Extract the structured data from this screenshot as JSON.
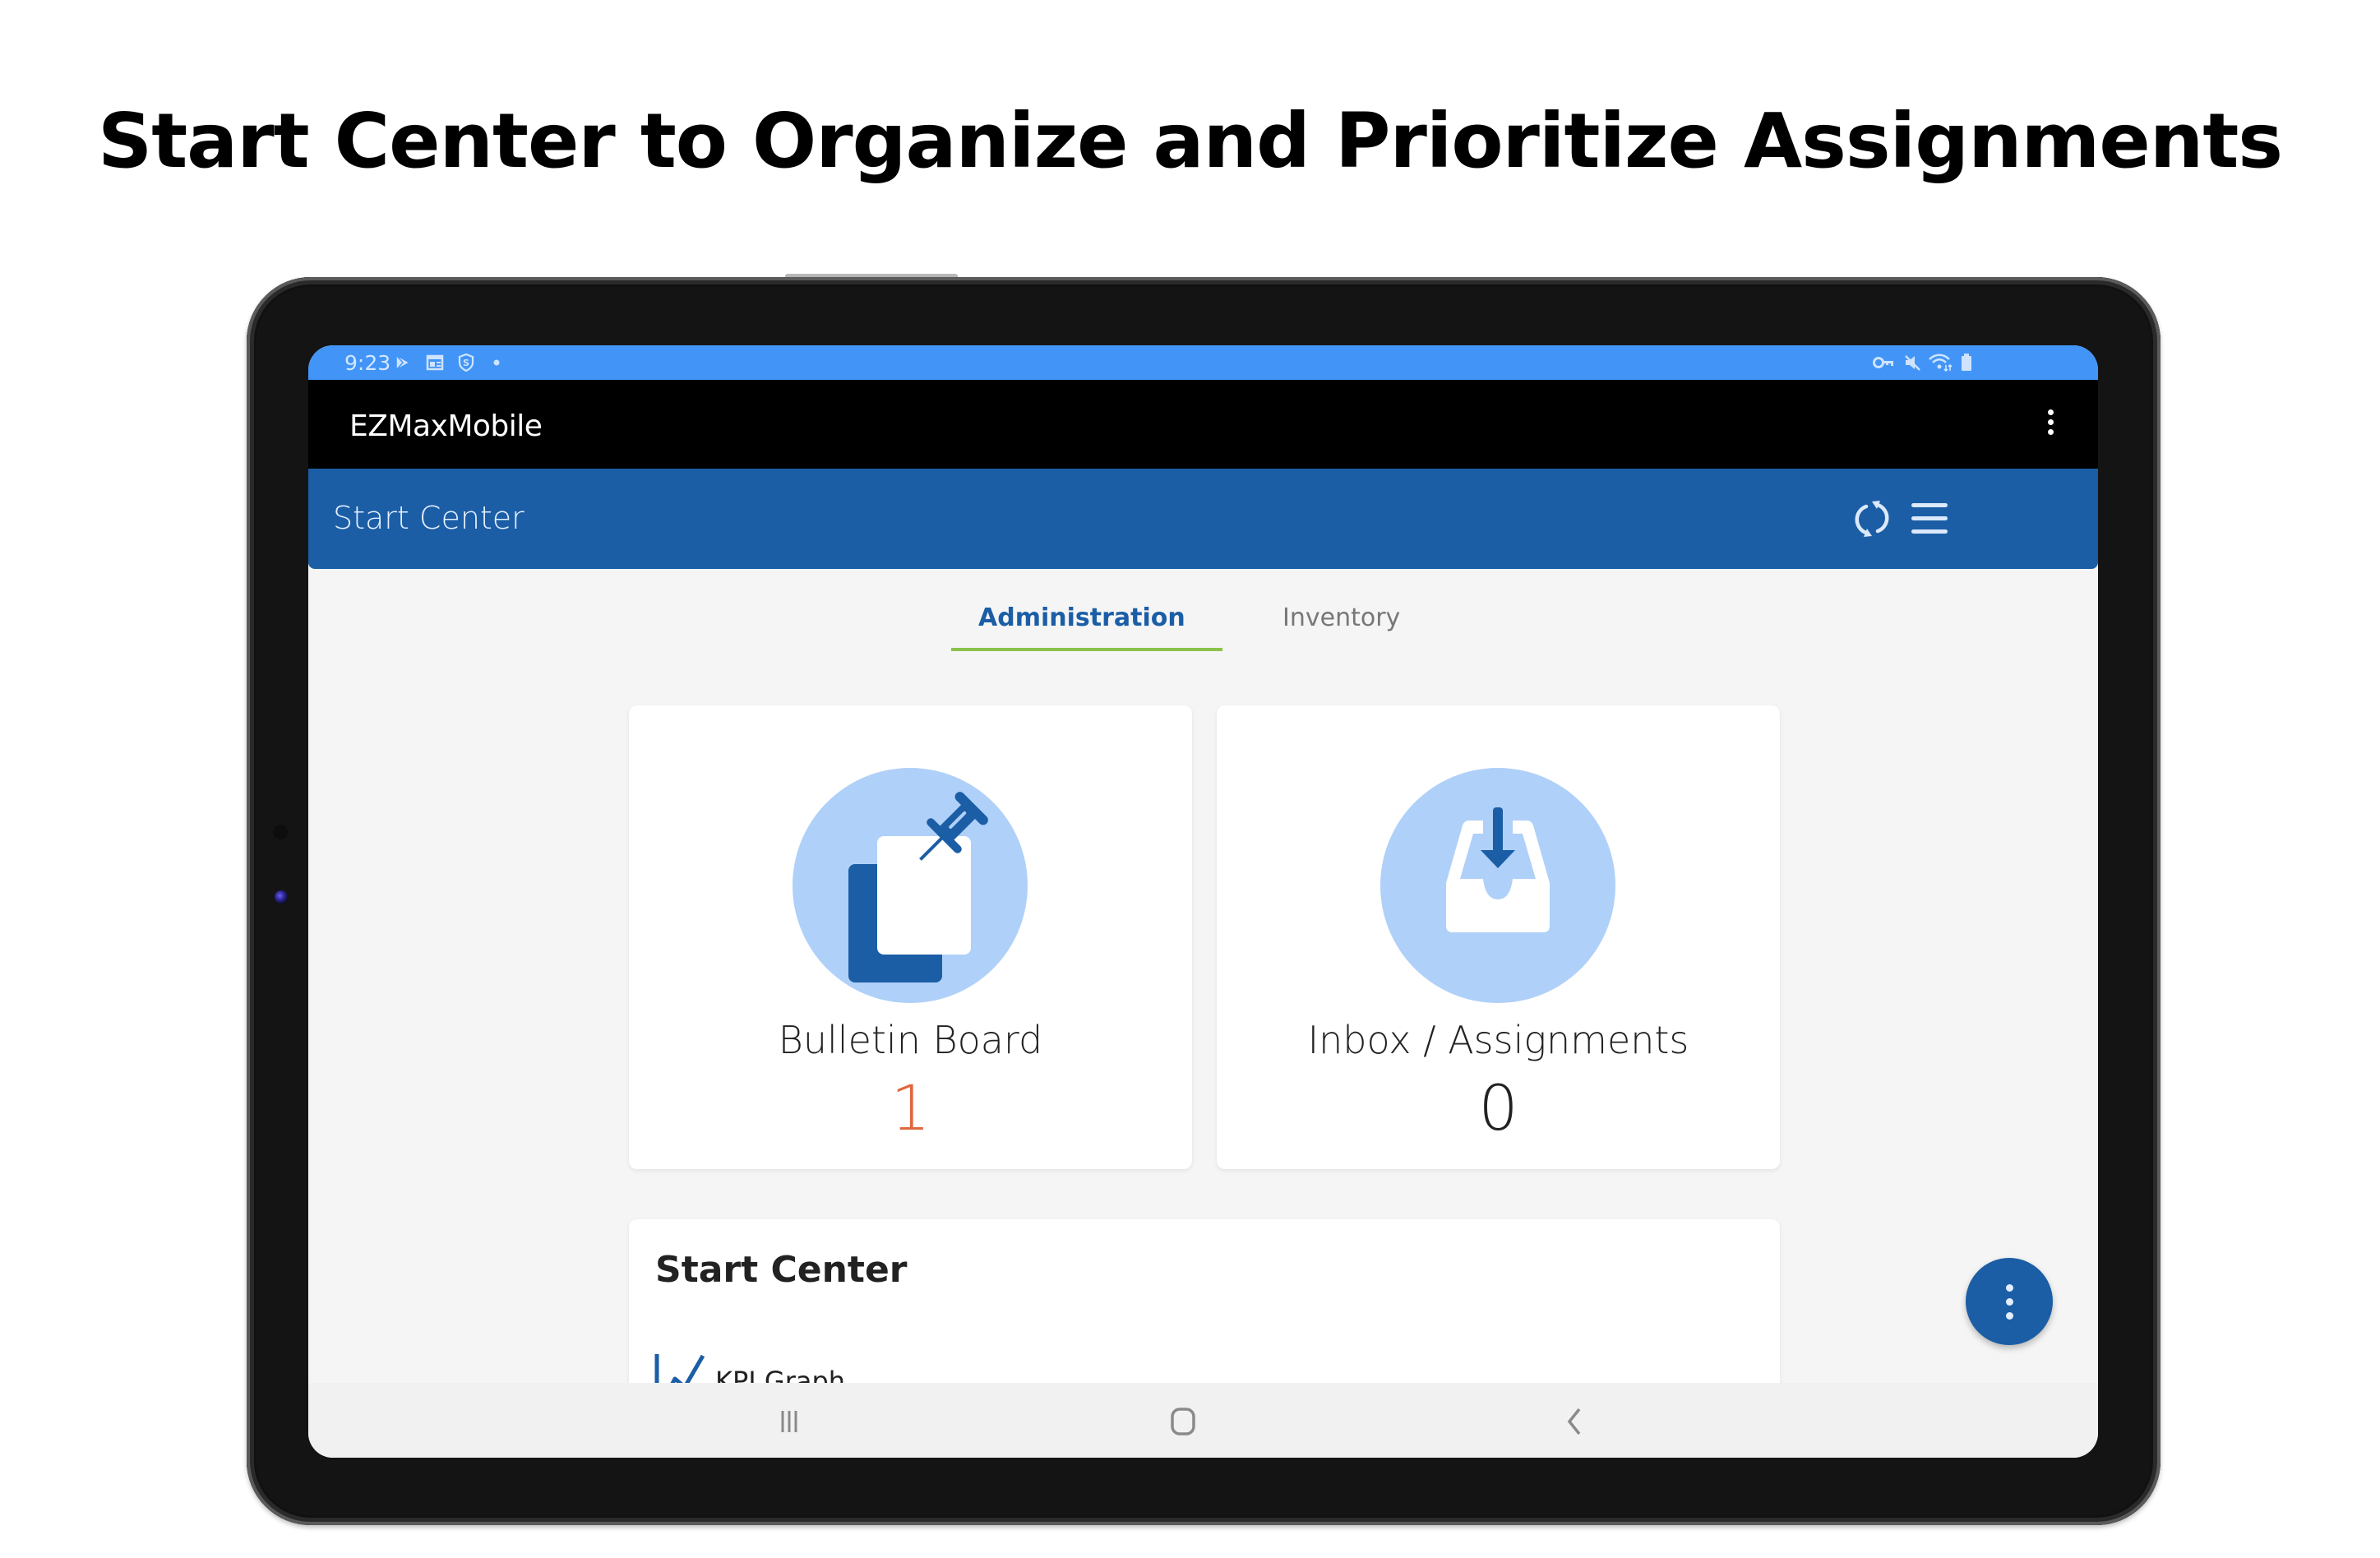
{
  "headline": "Start Center to Organize and Prioritize Assignments",
  "status_bar": {
    "time": "9:23",
    "left_icons": [
      "play-store-icon",
      "calendar-notification-icon",
      "shield-s-icon",
      "notification-dot-icon"
    ],
    "right_icons": [
      "vpn-key-icon",
      "mute-icon",
      "wifi-icon",
      "battery-icon"
    ]
  },
  "app_bar": {
    "title": "EZMaxMobile",
    "menu_icon": "more-vert-icon"
  },
  "header": {
    "title": "Start Center",
    "actions": [
      "sync-icon",
      "hamburger-menu-icon"
    ]
  },
  "tabs": [
    {
      "label": "Administration",
      "active": true
    },
    {
      "label": "Inventory",
      "active": false
    }
  ],
  "cards": [
    {
      "label": "Bulletin Board",
      "count": "1",
      "icon": "bulletin-pin-icon",
      "count_color": "#e0673f"
    },
    {
      "label": "Inbox / Assignments",
      "count": "0",
      "icon": "inbox-download-icon",
      "count_color": "#222222"
    }
  ],
  "panel": {
    "title": "Start Center",
    "items": [
      {
        "label": "KPI Graph",
        "icon": "line-chart-icon"
      }
    ]
  },
  "fab": {
    "icon": "more-vert-icon"
  },
  "nav_bar": [
    "recent-apps-icon",
    "home-icon",
    "back-icon"
  ],
  "colors": {
    "status_bar": "#4295f7",
    "header": "#1b5ea6",
    "tab_underline": "#8bc34a",
    "icon_circle": "#afd0f8",
    "accent": "#1b5ea6"
  }
}
